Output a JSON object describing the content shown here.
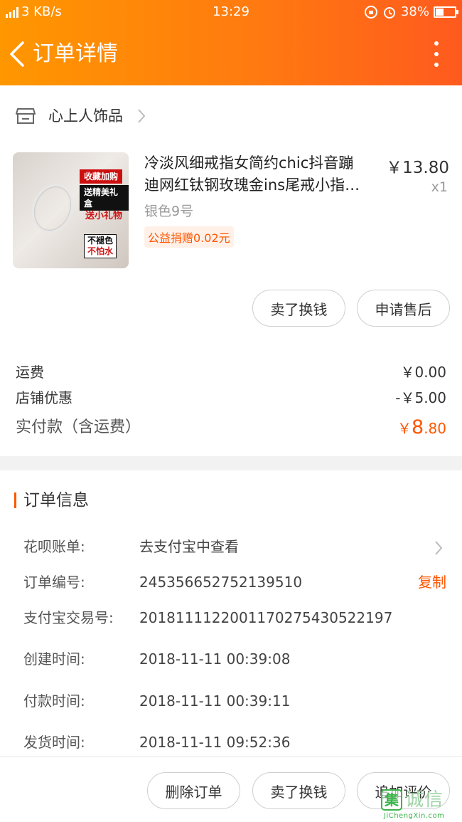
{
  "status_bar": {
    "network": "4G",
    "speed": "3 KB/s",
    "time": "13:29",
    "battery": "38%"
  },
  "nav": {
    "title": "订单详情"
  },
  "store": {
    "name": "心上人饰品"
  },
  "product": {
    "title_line1": "冷淡风细戒指女简约chic抖音蹦",
    "title_line2": "迪网红钛钢玫瑰金ins尾戒小指…",
    "price": "￥13.80",
    "qty": "x1",
    "sku": "银色9号",
    "charity": "公益捐赠0.02元",
    "thumb_tags": [
      "收藏加购",
      "送精美礼盒",
      "送小礼物",
      "不褪色",
      "不怕水"
    ]
  },
  "actions": {
    "sell": "卖了换钱",
    "after_sale": "申请售后"
  },
  "summary": {
    "shipping_label": "运费",
    "shipping_value": "￥0.00",
    "discount_label": "店铺优惠",
    "discount_value": "-￥5.00",
    "paid_label": "实付款（含运费）",
    "paid_symbol": "￥",
    "paid_int": "8",
    "paid_dec": ".80"
  },
  "order_info": {
    "title": "订单信息",
    "huabei_label": "花呗账单:",
    "huabei_value": "去支付宝中查看",
    "order_no_label": "订单编号:",
    "order_no_value": "245356652752139510",
    "copy_label": "复制",
    "alipay_label": "支付宝交易号:",
    "alipay_value": "2018111122001170275430522197",
    "created_label": "创建时间:",
    "created_value": "2018-11-11 00:39:08",
    "paid_time_label": "付款时间:",
    "paid_time_value": "2018-11-11 00:39:11",
    "shipped_label": "发货时间:",
    "shipped_value": "2018-11-11 09:52:36"
  },
  "bottom": {
    "delete": "删除订单",
    "sell": "卖了换钱",
    "review": "追加评价"
  },
  "watermark": {
    "box": "集",
    "cn": "诚信",
    "en": "JiChengXin.com"
  },
  "colors": {
    "accent": "#ff5500",
    "header_start": "#ff9700",
    "header_end": "#ff5a1e"
  }
}
